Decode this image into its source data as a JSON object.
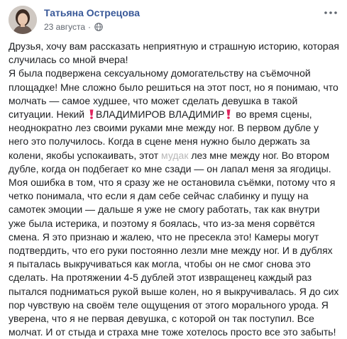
{
  "post": {
    "author": "Татьяна Острецова",
    "date": "23 августа",
    "separator": "·",
    "privacy_icon": "globe-icon",
    "options_icon": "more-horizontal-icon",
    "paragraph1": "Друзья, хочу вам рассказать неприятную и страшную историю, которая случилась со мной вчера!",
    "p2_part1": "Я была подвержена сексуальному домогательству на съёмочной площадке! Мне сложно было решиться на этот пост, но я понимаю, что молчать — самое худшее, что может сделать девушка в такой ситуации. Некий",
    "p2_name": "ВЛАДИМИРОВ ВЛАДИМИР",
    "p2_part2": "во время сцены, неоднократно лез своими руками мне между ног. В первом дубле у него это получилось. Когда в сцене меня нужно было держать за колени, якобы успокаивать, этот",
    "p2_blurred": "мудак",
    "p2_part3": "лез мне между ног. Во втором дубле, когда он подбегает ко мне сзади — он лапал меня за ягодицы. Моя ошибка в том, что я сразу же не остановила съёмки, потому что я четко понимала, что если я дам себе сейчас слабинку и пущу на самотек эмоции — дальше я уже не смогу работать, так как внутри уже была истерика, и поэтому я боялась, что из-за меня сорвётся смена. Я это признаю и жалею, что не пресекла это! Камеры могут подтвердить, что его руки постоянно лезли мне между ног. И в дублях я пыталась выкручиваться как могла, чтобы он не смог снова это сделать. На протяжении 4-5 дублей этот извращенец каждый раз пытался подниматься рукой выше колен, но я выкручивалась. Я до сих пор чувствую на своём теле ощущения от этого морального урода. Я уверена, что я не первая девушка, с которой он так поступил. Все молчат. И от стыда и страха мне тоже хотелось просто все это забыть!",
    "mark_icon": "red-exclamation-mark-icon",
    "colors": {
      "author": "#385898",
      "meta": "#616770",
      "text": "#1c1e21",
      "mark": "#e0245e"
    }
  }
}
